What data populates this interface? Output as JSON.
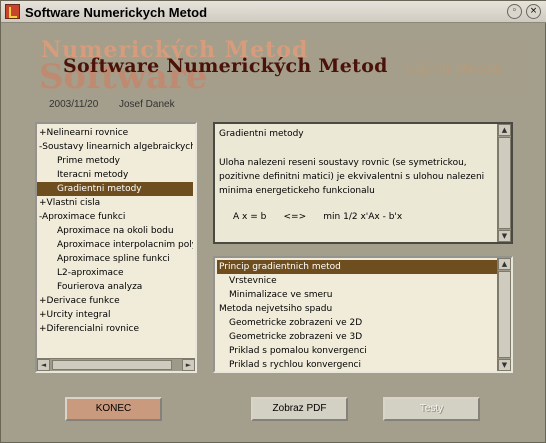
{
  "window": {
    "title": "Software Numerickych Metod",
    "pin_symbol": "◦",
    "close_symbol": "×"
  },
  "banner": {
    "title": "Software Numerických Metod",
    "ghost_top": "Numerických Metod",
    "ghost_big": "Software",
    "ghost_right": "ických Metod"
  },
  "meta": {
    "date": "2003/11/20",
    "author": "Josef Danek"
  },
  "tree": {
    "items": [
      {
        "label": "+Nelinearni rovnice",
        "indent": 0
      },
      {
        "label": "-Soustavy linearnich algebraickych",
        "indent": 0
      },
      {
        "label": "Prime metody",
        "indent": 1
      },
      {
        "label": "Iteracni metody",
        "indent": 1
      },
      {
        "label": "Gradientni metody",
        "indent": 1,
        "selected": true
      },
      {
        "label": "+Vlastni cisla",
        "indent": 0
      },
      {
        "label": "-Aproximace funkci",
        "indent": 0
      },
      {
        "label": "Aproximace na okoli bodu",
        "indent": 1
      },
      {
        "label": "Aproximace interpolacnim poly",
        "indent": 1
      },
      {
        "label": "Aproximace spline funkci",
        "indent": 1
      },
      {
        "label": "L2-aproximace",
        "indent": 1
      },
      {
        "label": "Fourierova analyza",
        "indent": 1
      },
      {
        "label": "+Derivace funkce",
        "indent": 0
      },
      {
        "label": "+Urcity integral",
        "indent": 0
      },
      {
        "label": "+Diferencialni rovnice",
        "indent": 0
      }
    ]
  },
  "description": {
    "title": "Gradientni metody",
    "body": "Uloha nalezeni reseni soustavy rovnic (se symetrickou, pozitivne definitni matici) je ekvivalentni s ulohou nalezeni minima energetickeho funkcionalu",
    "formula": "A x = b      <=>      min 1/2 x'Ax - b'x"
  },
  "topics": {
    "items": [
      {
        "label": "Princip gradientnich metod",
        "indent": 0,
        "selected": true
      },
      {
        "label": "Vrstevnice",
        "indent": 1
      },
      {
        "label": "Minimalizace ve smeru",
        "indent": 1
      },
      {
        "label": "Metoda nejvetsiho spadu",
        "indent": 0
      },
      {
        "label": "Geometricke zobrazeni ve 2D",
        "indent": 1
      },
      {
        "label": "Geometricke zobrazeni ve 3D",
        "indent": 1
      },
      {
        "label": "Priklad s pomalou konvergenci",
        "indent": 1
      },
      {
        "label": "Priklad s rychlou konvergenci",
        "indent": 1
      }
    ]
  },
  "buttons": {
    "konec": "KONEC",
    "pdf": "Zobraz PDF",
    "testy": "Testy"
  },
  "scroll": {
    "left": "◄",
    "right": "►",
    "up": "▲",
    "down": "▼"
  },
  "colors": {
    "selection": "#6e4e1e",
    "banner_title": "#4a1208",
    "konec_button": "#c99a7e"
  }
}
